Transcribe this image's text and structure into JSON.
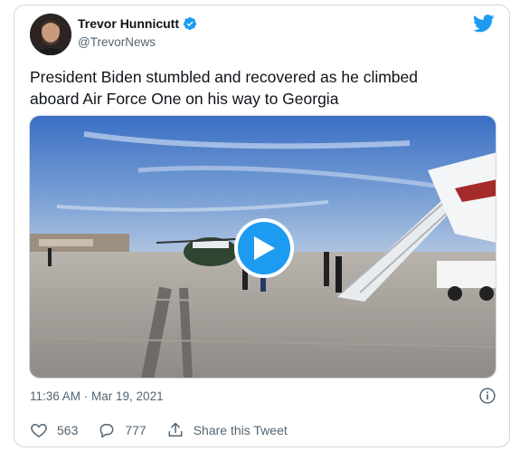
{
  "tweet": {
    "author": {
      "display_name": "Trevor Hunnicutt",
      "handle": "@TrevorNews",
      "verified": true
    },
    "text": "President Biden stumbled and recovered as he climbed\naboard Air Force One on his way to Georgia",
    "media": {
      "type": "video",
      "play_icon": "play-icon"
    },
    "timestamp": "11:36 AM · Mar 19, 2021",
    "likes": "563",
    "replies": "777",
    "share_label": "Share this Tweet"
  },
  "icons": {
    "brand": "twitter-bird-icon",
    "verified": "verified-badge-icon",
    "info": "info-icon",
    "like": "heart-icon",
    "reply": "reply-bubble-icon",
    "share": "share-icon"
  },
  "colors": {
    "accent": "#1d9bf0",
    "text": "#0f1419",
    "secondary": "#536471",
    "border": "#cfd9de"
  }
}
